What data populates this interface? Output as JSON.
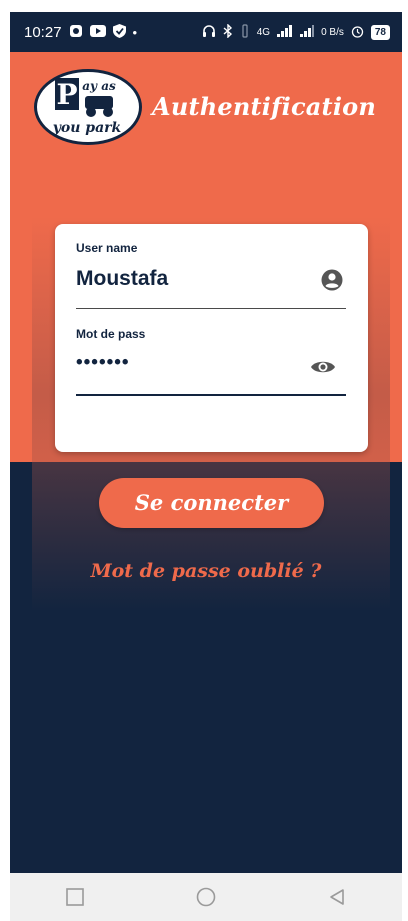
{
  "status_bar": {
    "time": "10:27",
    "network": "4G",
    "speed": "0 B/s",
    "battery": "78",
    "icons": [
      "notification-icon",
      "youtube-icon",
      "shield-icon",
      "dot-icon",
      "headphones-icon",
      "bluetooth-icon",
      "vibrate-icon",
      "signal-icon",
      "signal-icon",
      "alarm-icon"
    ]
  },
  "header": {
    "title": "Authentification",
    "logo_text_top": "ay as",
    "logo_letter": "P",
    "logo_text_bottom": "you park"
  },
  "form": {
    "username_label": "User name",
    "username_value": "Moustafa",
    "password_label": "Mot de pass",
    "password_value": "•••••••"
  },
  "actions": {
    "login_label": "Se connecter",
    "forgot_label": "Mot de passe oublié ?"
  },
  "colors": {
    "accent": "#ef6a4b",
    "dark": "#12243f"
  }
}
